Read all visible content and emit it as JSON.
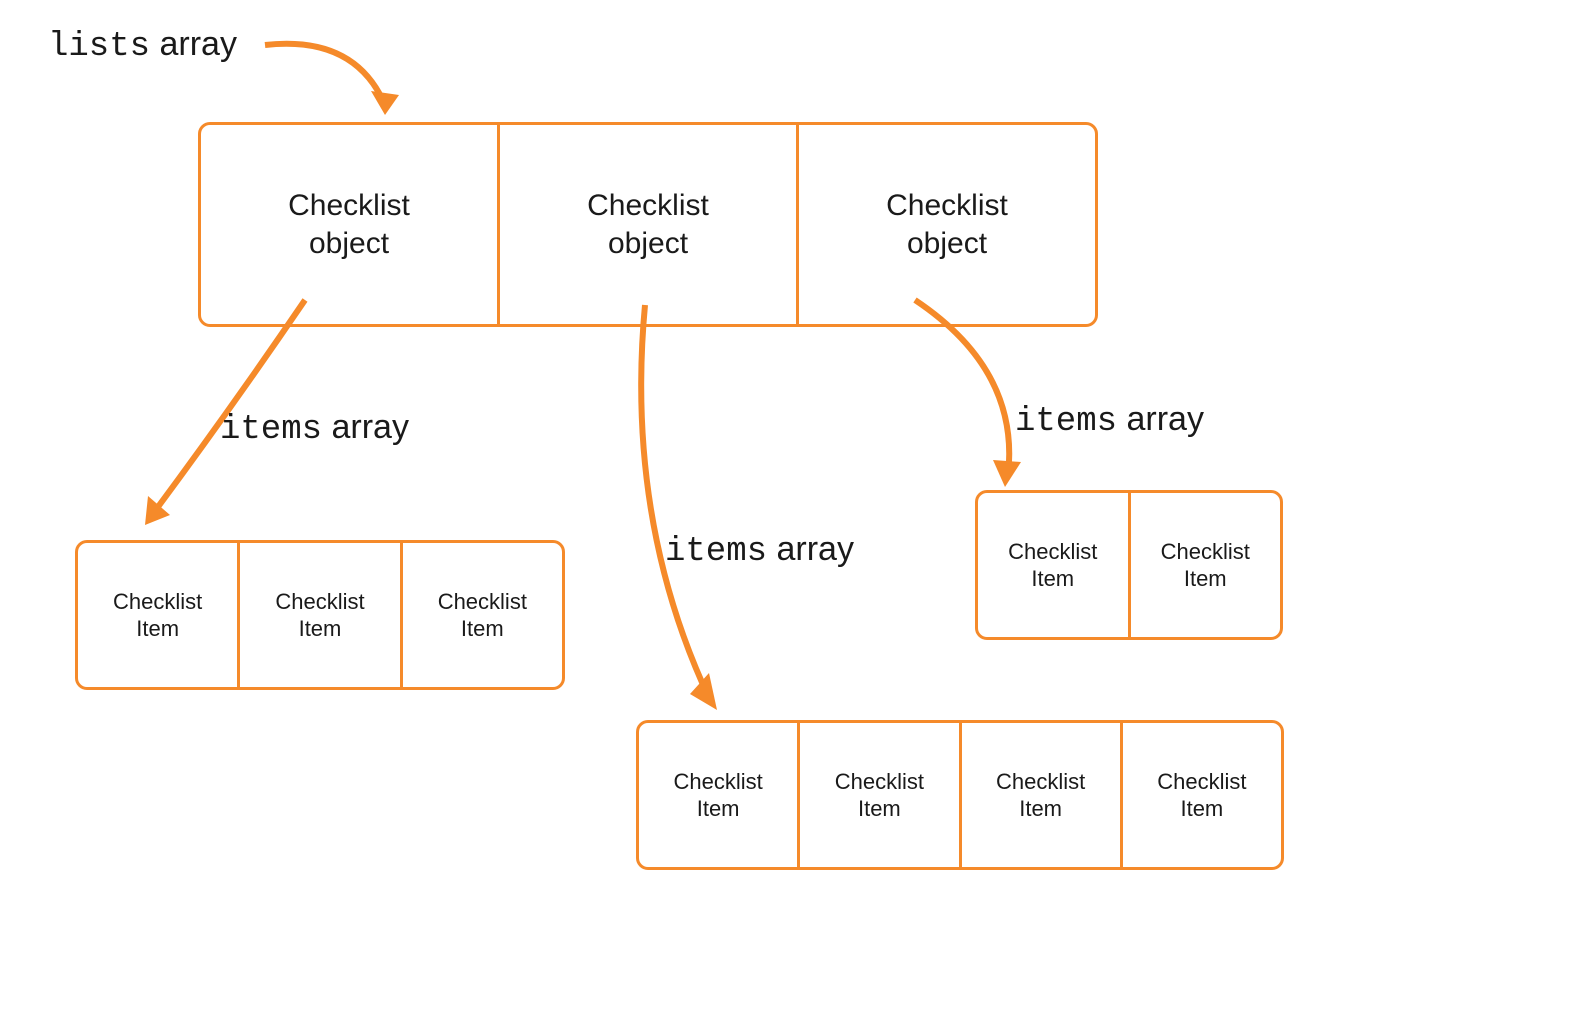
{
  "labels": {
    "lists_array_mono": "lists",
    "lists_array_rest": " array",
    "items_array_mono": "items",
    "items_array_rest": " array"
  },
  "top_box": {
    "cells": [
      "Checklist object",
      "Checklist object",
      "Checklist object"
    ]
  },
  "box_left": {
    "cells": [
      "Checklist Item",
      "Checklist Item",
      "Checklist Item"
    ]
  },
  "box_middle": {
    "cells": [
      "Checklist Item",
      "Checklist Item",
      "Checklist Item",
      "Checklist Item"
    ]
  },
  "box_right": {
    "cells": [
      "Checklist Item",
      "Checklist Item"
    ]
  },
  "colors": {
    "orange": "#f58a2a"
  }
}
